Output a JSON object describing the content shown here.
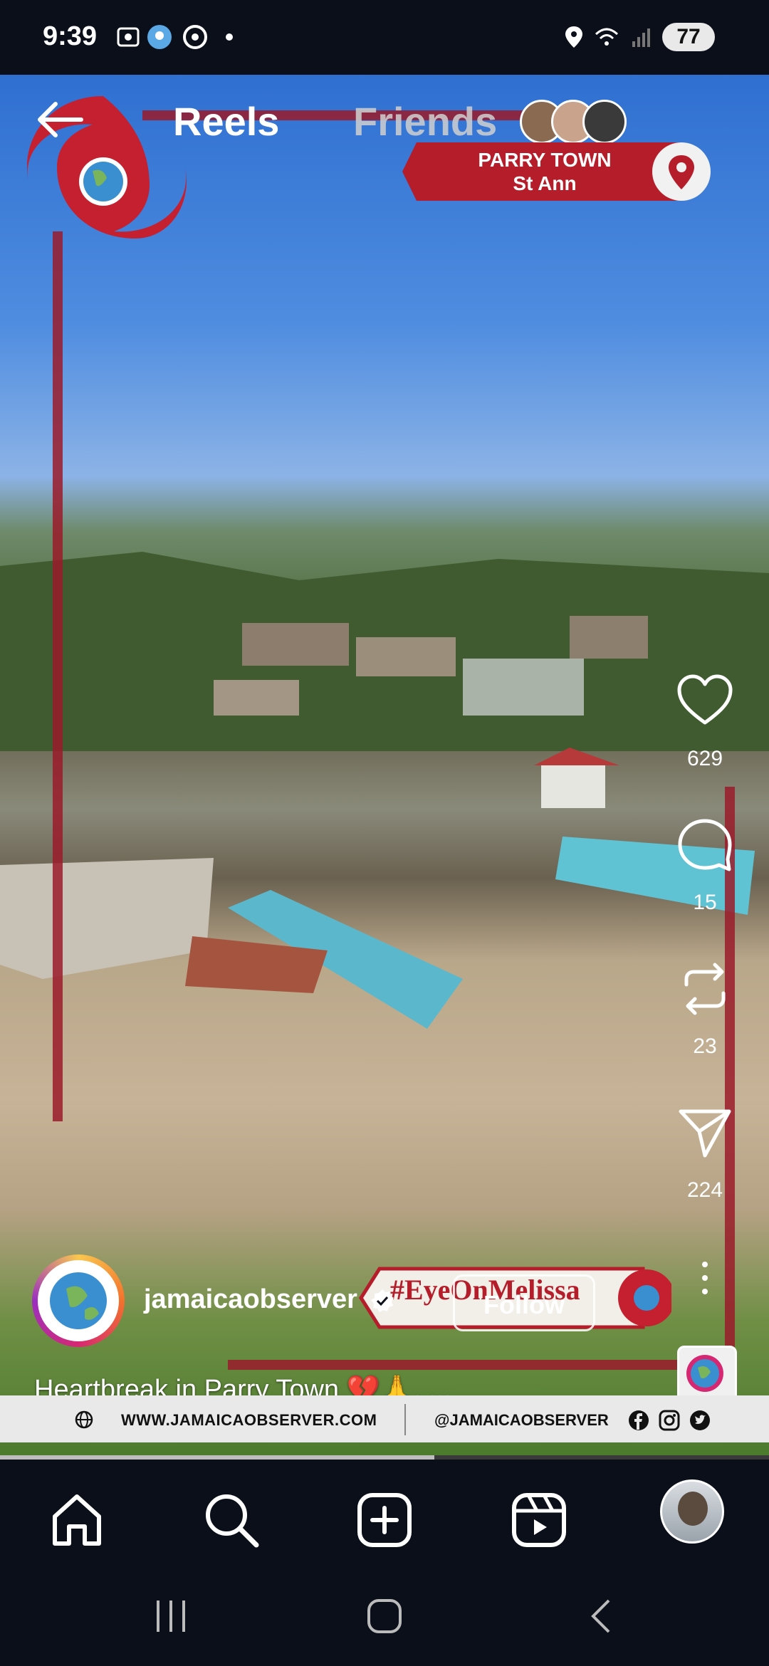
{
  "status_bar": {
    "time": "9:39",
    "battery": "77",
    "icons": [
      "screenshot-icon",
      "location-app-icon",
      "chrome-icon",
      "dot-icon",
      "location-icon",
      "wifi-icon",
      "signal-icon",
      "battery-icon"
    ]
  },
  "top_nav": {
    "back_icon": "back-arrow-icon",
    "tabs": [
      {
        "label": "Reels",
        "active": true
      },
      {
        "label": "Friends",
        "active": false
      }
    ]
  },
  "location_badge": {
    "line1": "PARRY TOWN",
    "line2": "St Ann",
    "icon": "map-pin-icon"
  },
  "actions": {
    "like_count": "629",
    "comment_count": "15",
    "repost_count": "23",
    "share_count": "224"
  },
  "post": {
    "author": "jamaicaobserver",
    "verified": true,
    "follow_label": "Follow",
    "hashtag_overlay": "#EyeOnMelissa",
    "caption": "Heartbreak in Parry Town 💔🙏. ..."
  },
  "banner": {
    "website": "WWW.JAMAICAOBSERVER.COM",
    "handle": "@JAMAICAOBSERVER",
    "social_icons": [
      "facebook-icon",
      "instagram-icon",
      "twitter-icon"
    ]
  },
  "video_progress": 0.565,
  "bottom_nav": [
    "home-icon",
    "search-icon",
    "create-icon",
    "reels-icon",
    "profile-avatar"
  ],
  "colors": {
    "brand_red": "#b51d2a",
    "background": "#0b0f1a"
  }
}
